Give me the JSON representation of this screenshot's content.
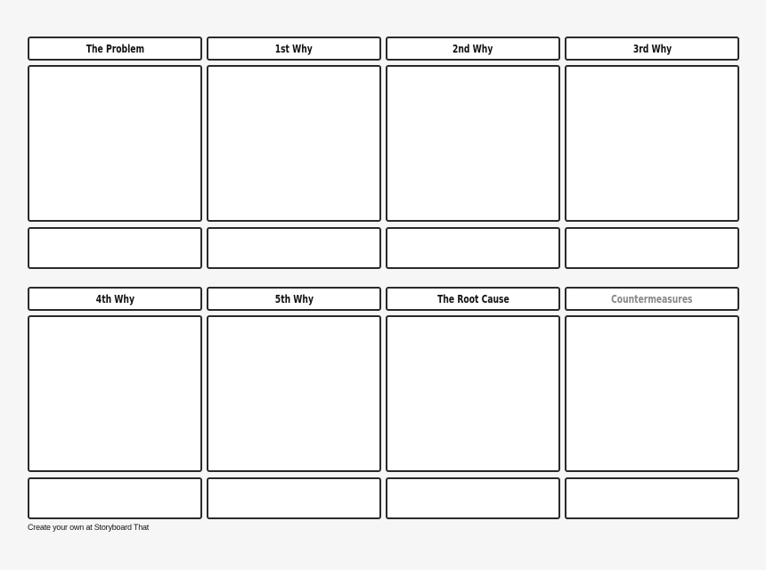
{
  "cells": [
    {
      "title": "The Problem"
    },
    {
      "title": "1st Why"
    },
    {
      "title": "2nd Why"
    },
    {
      "title": "3rd Why"
    },
    {
      "title": "4th Why"
    },
    {
      "title": "5th Why"
    },
    {
      "title": "The Root Cause"
    },
    {
      "title": "Countermeasures"
    }
  ],
  "colors": {
    "border": "#2a2a2a",
    "muted_title": "#888888",
    "background": "#f6f6f6"
  },
  "footer": "Create your own at Storyboard That"
}
